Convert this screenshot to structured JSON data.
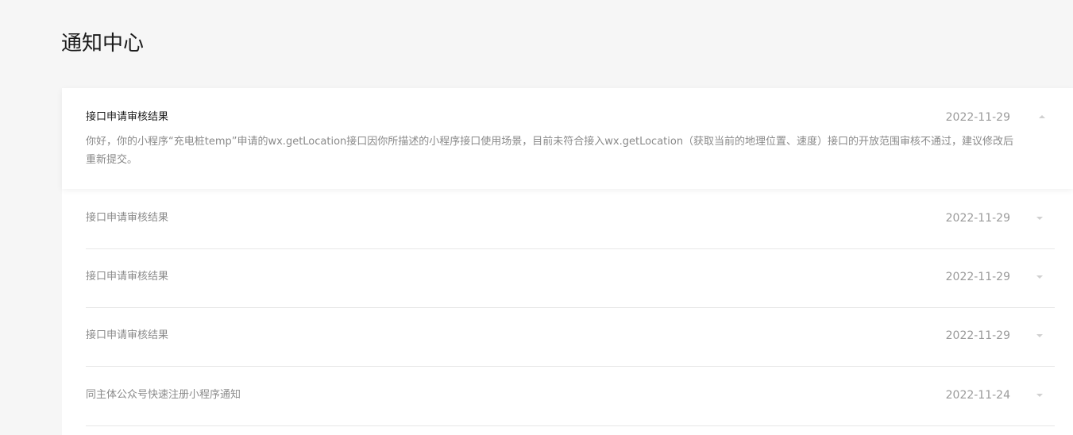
{
  "page": {
    "title": "通知中心"
  },
  "notices": [
    {
      "title": "接口申请审核结果",
      "date": "2022-11-29",
      "expanded": true,
      "content": "你好，你的小程序“充电桩temp”申请的wx.getLocation接口因你所描述的小程序接口使用场景，目前未符合接入wx.getLocation（获取当前的地理位置、速度）接口的开放范围审核不通过，建议修改后重新提交。",
      "arrow_icon": "chevron-up-icon"
    },
    {
      "title": "接口申请审核结果",
      "date": "2022-11-29",
      "expanded": false,
      "arrow_icon": "chevron-down-icon"
    },
    {
      "title": "接口申请审核结果",
      "date": "2022-11-29",
      "expanded": false,
      "arrow_icon": "chevron-down-icon"
    },
    {
      "title": "接口申请审核结果",
      "date": "2022-11-29",
      "expanded": false,
      "arrow_icon": "chevron-down-icon"
    },
    {
      "title": "同主体公众号快速注册小程序通知",
      "date": "2022-11-24",
      "expanded": false,
      "arrow_icon": "chevron-down-icon"
    }
  ],
  "colors": {
    "background": "#f6f6f6",
    "panel": "#ffffff",
    "title_text": "#1a1a1a",
    "muted_text": "#8a8a8a",
    "divider": "#e7e7e7"
  }
}
